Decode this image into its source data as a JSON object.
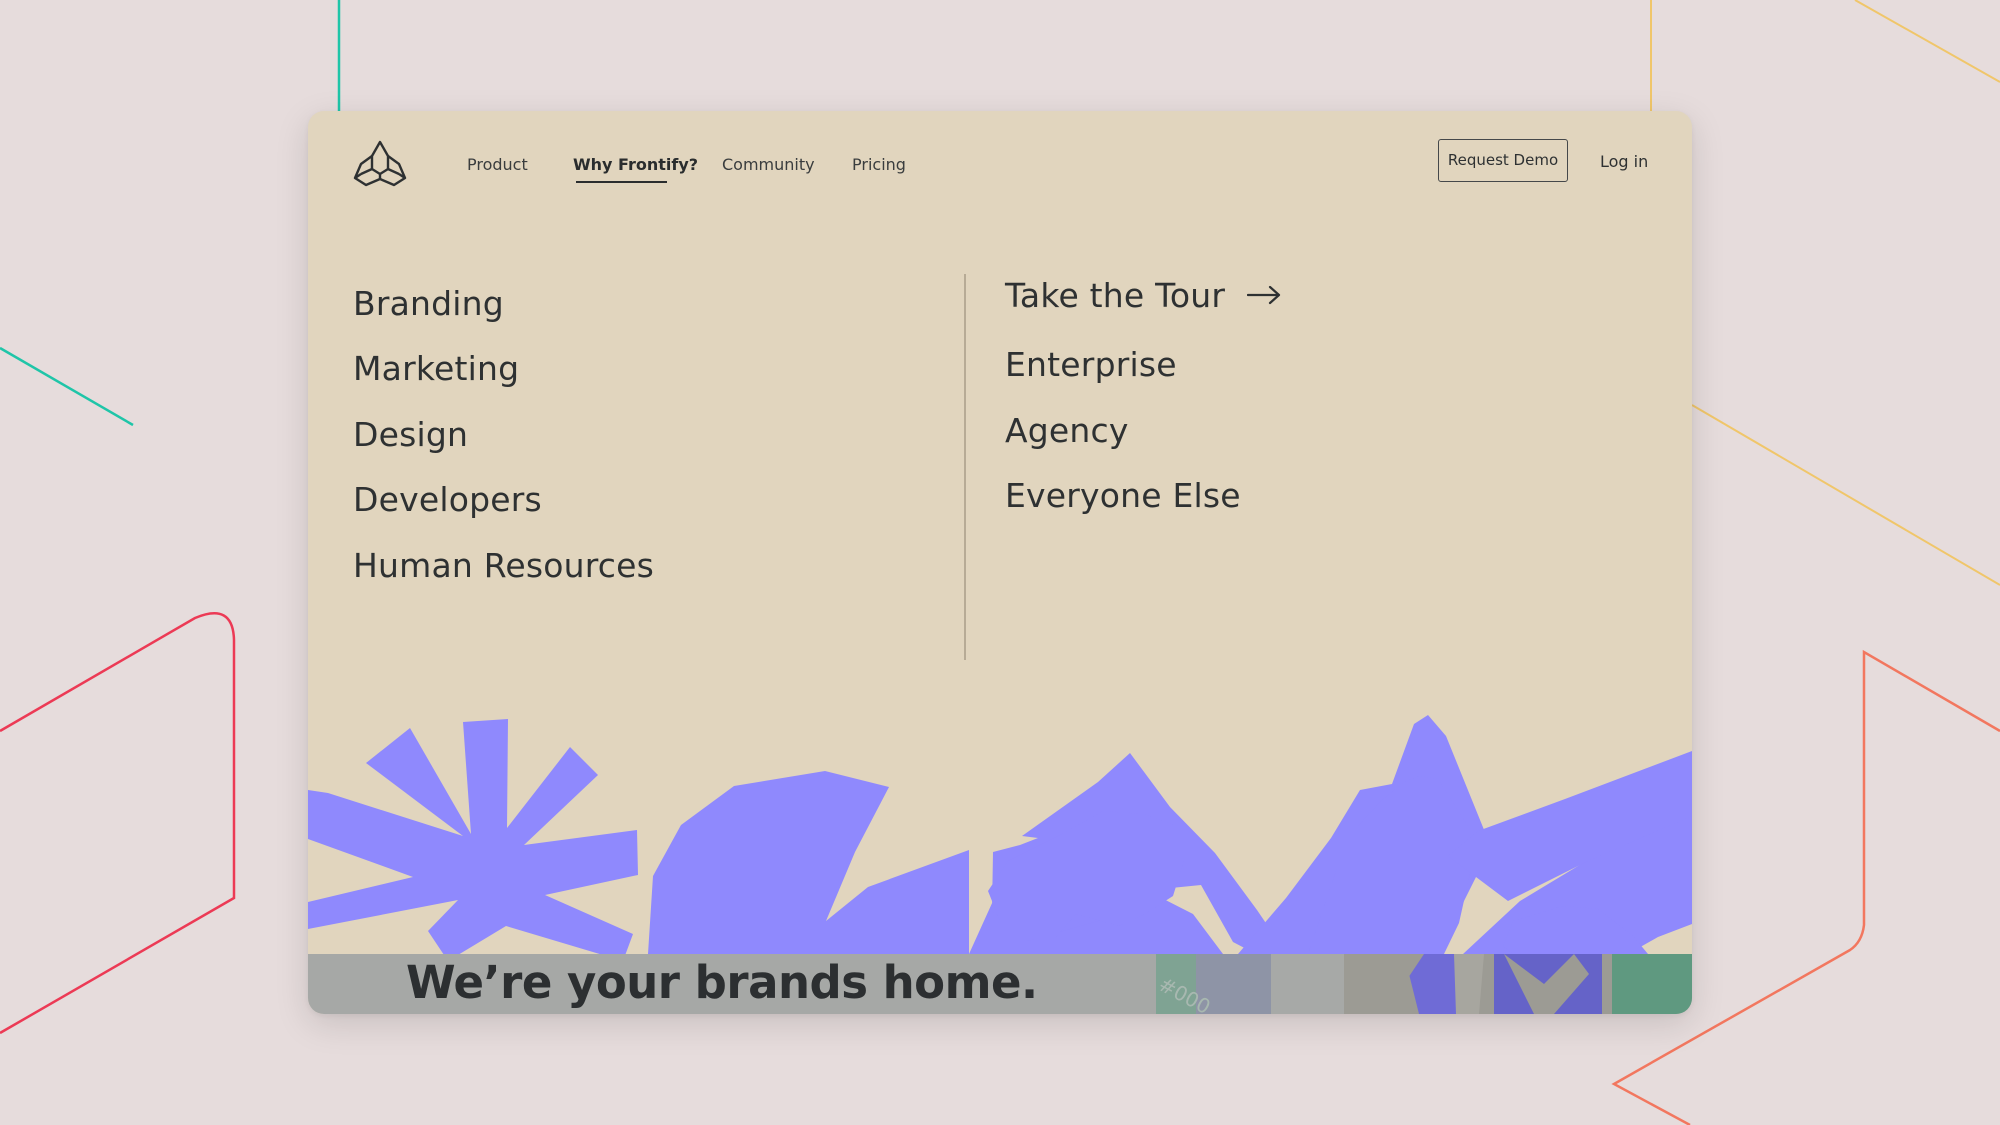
{
  "colors": {
    "page_background": "#e6dcdc",
    "window_background": "#e1d5be",
    "text": "#2e3132",
    "accent_purple": "#8f89fd",
    "line_teal": "#1fc5a8",
    "line_orange": "#f0c66a",
    "line_red": "#ec3a55",
    "line_salmon": "#f2775f"
  },
  "nav": {
    "logo_icon": "frontify-logo-icon",
    "items": [
      {
        "label": "Product"
      },
      {
        "label": "Why Frontify?",
        "active": true
      },
      {
        "label": "Community"
      },
      {
        "label": "Pricing"
      }
    ],
    "request_demo_label": "Request Demo",
    "login_label": "Log in"
  },
  "menu": {
    "left": [
      "Branding",
      "Marketing",
      "Design",
      "Developers",
      "Human Resources"
    ],
    "right": {
      "tour_label": "Take the Tour",
      "tour_icon": "arrow-right-icon",
      "items": [
        "Enterprise",
        "Agency",
        "Everyone Else"
      ]
    }
  },
  "hero": {
    "tagline": "We’re your brands home.",
    "swatch_text": "#000"
  }
}
